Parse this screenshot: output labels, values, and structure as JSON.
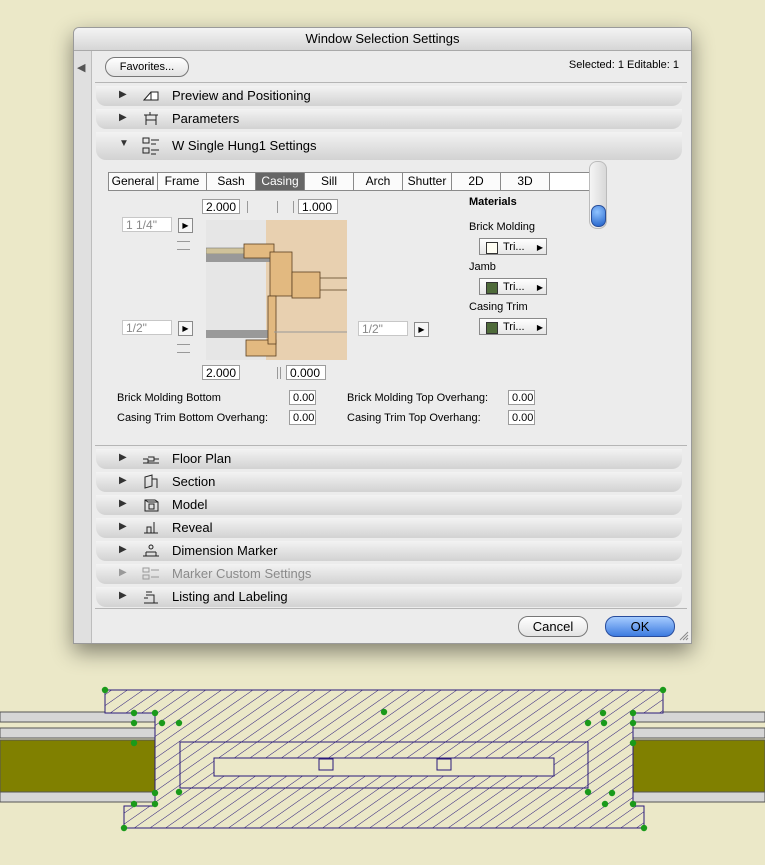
{
  "dialog": {
    "title": "Window Selection Settings",
    "favorites_label": "Favorites...",
    "selection_info": "Selected: 1 Editable: 1",
    "panels_top": [
      {
        "label": "Preview and Positioning",
        "icon": "preview-positioning-icon"
      },
      {
        "label": "Parameters",
        "icon": "parameters-icon"
      },
      {
        "label": "W Single Hung1 Settings",
        "icon": "settings-icon"
      }
    ],
    "tabs": [
      "General",
      "Frame",
      "Sash",
      "Casing",
      "Sill",
      "Arch",
      "Shutter",
      "2D",
      "3D"
    ],
    "active_tab": "Casing",
    "casing": {
      "top_left_value": "2.000",
      "top_right_value": "1.000",
      "bottom_left_value": "2.000",
      "bottom_right_value": "0.000",
      "left_upper_field": "1 1/4\"",
      "left_lower_field": "1/2\"",
      "right_field": "1/2\""
    },
    "materials": {
      "heading": "Materials",
      "items": [
        {
          "label": "Brick Molding",
          "value": "Tri...",
          "color": "#fffef4"
        },
        {
          "label": "Jamb",
          "value": "Tri...",
          "color": "#4f6b3a"
        },
        {
          "label": "Casing Trim",
          "value": "Tri...",
          "color": "#4f6b3a"
        }
      ]
    },
    "fields": [
      {
        "label": "Brick Molding Bottom",
        "value": "0.00"
      },
      {
        "label": "Casing Trim Bottom Overhang:",
        "value": "0.00"
      },
      {
        "label": "Brick Molding Top Overhang:",
        "value": "0.00"
      },
      {
        "label": "Casing Trim Top Overhang:",
        "value": "0.00"
      }
    ],
    "panels_bottom": [
      {
        "label": "Floor Plan",
        "icon": "floor-plan-icon",
        "enabled": true
      },
      {
        "label": "Section",
        "icon": "section-icon",
        "enabled": true
      },
      {
        "label": "Model",
        "icon": "model-icon",
        "enabled": true
      },
      {
        "label": "Reveal",
        "icon": "reveal-icon",
        "enabled": true
      },
      {
        "label": "Dimension Marker",
        "icon": "dimension-marker-icon",
        "enabled": true
      },
      {
        "label": "Marker Custom Settings",
        "icon": "marker-custom-icon",
        "enabled": false
      },
      {
        "label": "Listing and Labeling",
        "icon": "listing-labeling-icon",
        "enabled": true
      }
    ],
    "cancel_label": "Cancel",
    "ok_label": "OK"
  },
  "colors": {
    "background": "#ebe8c8",
    "wall_fill": "#808000",
    "hatch": "#2a1a7a",
    "selection_point": "#1a9a1a",
    "ok_button": "#3d7be0"
  }
}
